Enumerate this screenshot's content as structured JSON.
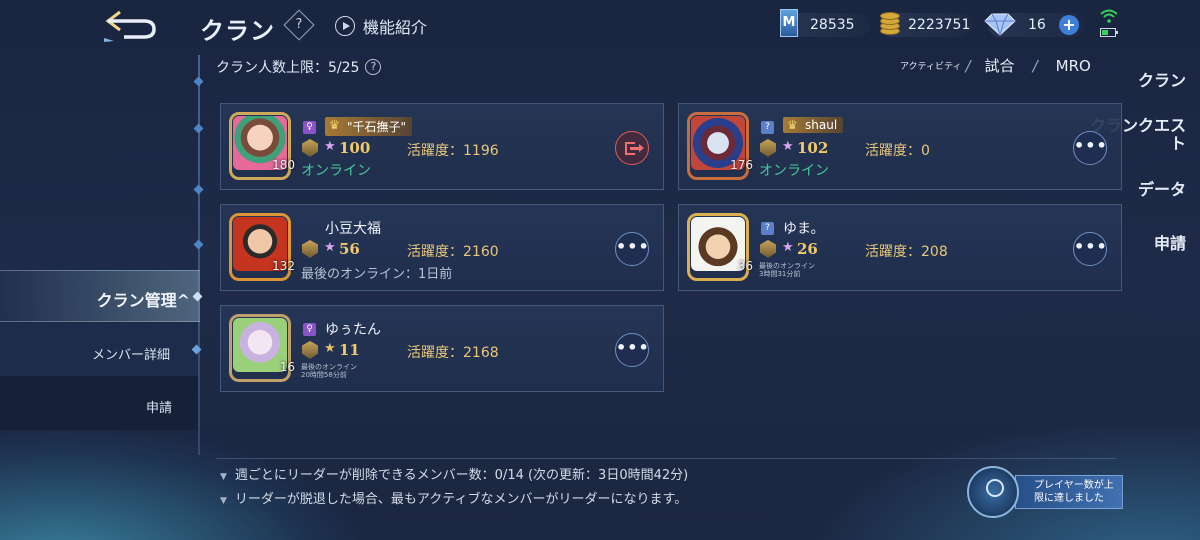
{
  "header": {
    "title": "クラン",
    "help_glyph": "?",
    "feature_intro_label": "機能紹介"
  },
  "currencies": {
    "m_points": "28535",
    "gold": "2223751",
    "diamonds": "16",
    "m_icon_glyph": "M",
    "plus_glyph": "+"
  },
  "sidebar": {
    "items": [
      {
        "label": "クラン"
      },
      {
        "label": "クランクエスト"
      },
      {
        "label": "データ"
      },
      {
        "label": "申請"
      },
      {
        "label": "クラン管理^"
      }
    ],
    "sub_items": [
      {
        "label": "メンバー詳細"
      },
      {
        "label": "申請"
      }
    ]
  },
  "member_limit": {
    "label": "クラン人数上限：5/25",
    "help_glyph": "?"
  },
  "sort_tabs": {
    "activity": "アクティビティ",
    "match": "試合",
    "mro": "MRO",
    "separator": "/"
  },
  "members": [
    {
      "name": "\"千石撫子\"",
      "is_leader": true,
      "gender_glyph": "♀",
      "level": "180",
      "stars": "100",
      "activity": "活躍度：1196",
      "status": "オンライン",
      "status_type": "online",
      "action": "exit"
    },
    {
      "name": "shaul",
      "is_leader": true,
      "gender_glyph": "?",
      "level": "176",
      "stars": "102",
      "activity": "活躍度：0",
      "status": "オンライン",
      "status_type": "online",
      "action": "more"
    },
    {
      "name": "小豆大福",
      "is_leader": false,
      "gender_glyph": "♀",
      "level": "132",
      "stars": "56",
      "activity": "活躍度：2160",
      "status": "最後のオンライン：1日前",
      "status_type": "last",
      "action": "more"
    },
    {
      "name": "ゆま。",
      "is_leader": false,
      "gender_glyph": "?",
      "level": "36",
      "stars": "26",
      "activity": "活躍度：208",
      "status_line1": "最後のオンライン",
      "status_line2": "3時間31分前",
      "status_type": "tiny",
      "action": "more"
    },
    {
      "name": "ゆぅたん",
      "is_leader": false,
      "gender_glyph": "♀",
      "level": "16",
      "stars": "11",
      "activity": "活躍度：2168",
      "status_line1": "最後のオンライン",
      "status_line2": "20時間58分前",
      "status_type": "tiny",
      "action": "more"
    }
  ],
  "more_glyph": "•••",
  "star_glyph": "★",
  "crown_glyph": "♛",
  "footer": {
    "note1": "週ごとにリーダーが削除できるメンバー数：0/14 (次の更新：3日0時間42分)",
    "note2": "リーダーが脱退した場合、最もアクティブなメンバーがリーダーになります。",
    "player_limit_line1": "プレイヤー数が上",
    "player_limit_line2": "限に達しました"
  },
  "colors": {
    "background": "#1c2742",
    "online": "#48c79a",
    "activity": "#e9c77a",
    "stars": "#f1c968",
    "exit": "#e05a5a",
    "accent": "#3f7fd8"
  }
}
